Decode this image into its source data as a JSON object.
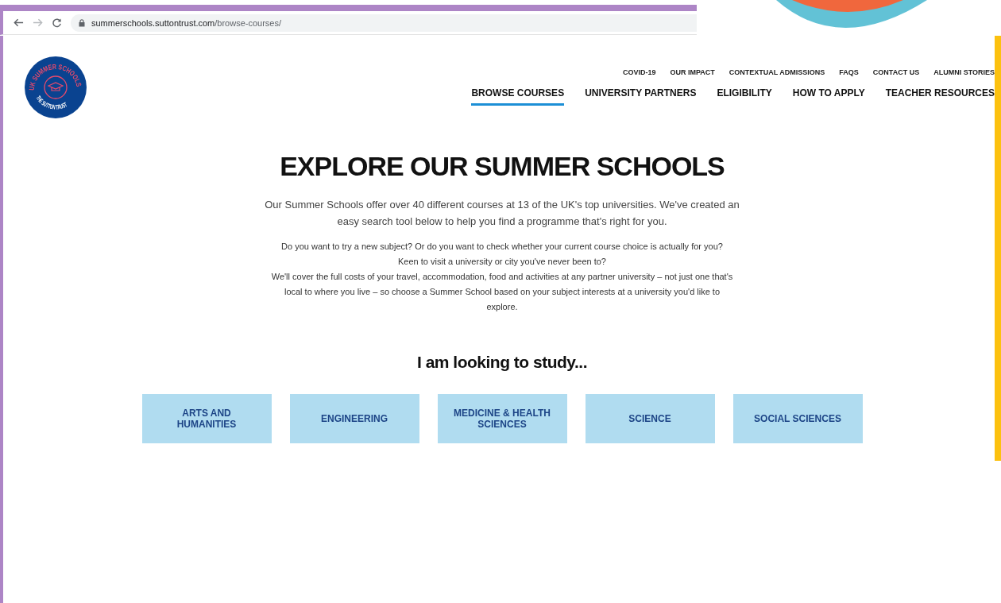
{
  "browser": {
    "url_domain": "summerschools.suttontrust.com",
    "url_path": "/browse-courses/"
  },
  "logo": {
    "top_text": "UK SUMMER SCHOOLS",
    "bottom_text": "THE SUTTON TRUST"
  },
  "secondary_nav": [
    "COVID-19",
    "OUR IMPACT",
    "CONTEXTUAL ADMISSIONS",
    "FAQS",
    "CONTACT US",
    "ALUMNI STORIES"
  ],
  "main_nav": [
    {
      "label": "BROWSE COURSES",
      "selected": true
    },
    {
      "label": "UNIVERSITY PARTNERS",
      "selected": false
    },
    {
      "label": "ELIGIBILITY",
      "selected": false
    },
    {
      "label": "HOW TO APPLY",
      "selected": false
    },
    {
      "label": "TEACHER RESOURCES",
      "selected": false
    }
  ],
  "heading": "EXPLORE OUR SUMMER SCHOOLS",
  "intro": "Our Summer Schools offer over 40 different courses at 13 of the UK's top universities. We've created an easy search tool below to help you find a programme that's right for you.",
  "details": [
    "Do you want to try a new subject? Or do you want to check whether your current course choice is actually for you?",
    "Keen to visit a university or city you've never been to?",
    "We'll cover the full costs of your travel, accommodation, food and activities at any partner university – not just one that's local to where you live – so choose a Summer School based on your subject interests at a university you'd like to explore."
  ],
  "study_heading": "I am looking to study...",
  "categories": [
    "ARTS AND HUMANITIES",
    "ENGINEERING",
    "MEDICINE & HEALTH SCIENCES",
    "SCIENCE",
    "SOCIAL SCIENCES"
  ]
}
